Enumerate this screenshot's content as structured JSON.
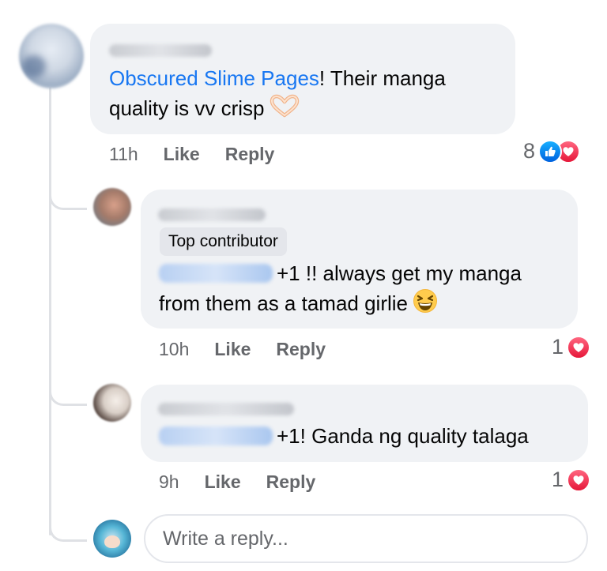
{
  "colors": {
    "link": "#1877f2",
    "like": "#1877f2",
    "love": "#f33e58",
    "bubble": "#f0f2f5",
    "meta": "#65676b"
  },
  "comments": [
    {
      "text_link": "Obscured Slime Pages",
      "text_after": "! Their manga",
      "text_line2": "quality is vv crisp",
      "emoji": "heart-hands-emoji",
      "time": "11h",
      "like_label": "Like",
      "reply_label": "Reply",
      "reaction_count": "8",
      "reactions": [
        "like-icon",
        "love-icon"
      ]
    },
    {
      "badge": "Top contributor",
      "text_line1": "+1 !! always get my manga",
      "text_line2": "from them as a tamad girlie",
      "emoji": "grinning-squinting-emoji",
      "time": "10h",
      "like_label": "Like",
      "reply_label": "Reply",
      "reaction_count": "1",
      "reactions": [
        "love-icon"
      ]
    },
    {
      "text_line1": "+1! Ganda ng quality talaga",
      "time": "9h",
      "like_label": "Like",
      "reply_label": "Reply",
      "reaction_count": "1",
      "reactions": [
        "love-icon"
      ]
    }
  ],
  "reply_box": {
    "placeholder": "Write a reply..."
  }
}
